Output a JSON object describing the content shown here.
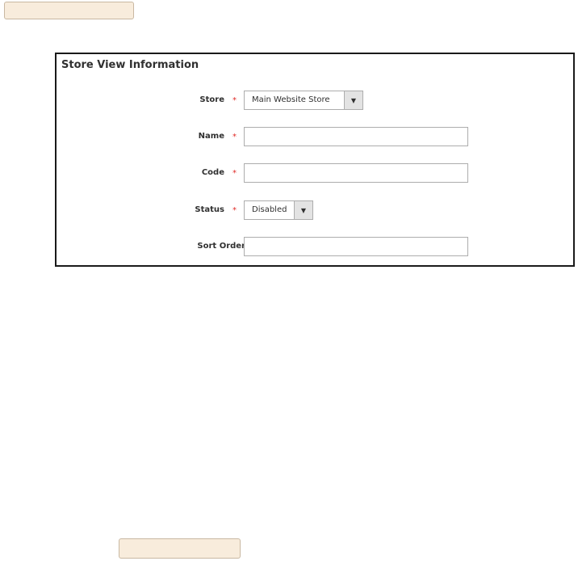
{
  "panel": {
    "title": "Store View Information"
  },
  "fields": {
    "store": {
      "label": "Store",
      "required_mark": "*",
      "value": "Main Website Store"
    },
    "name": {
      "label": "Name",
      "required_mark": "*",
      "value": ""
    },
    "code": {
      "label": "Code",
      "required_mark": "*",
      "value": ""
    },
    "status": {
      "label": "Status",
      "required_mark": "*",
      "value": "Disabled"
    },
    "sort_order": {
      "label": "Sort Order",
      "value": ""
    }
  },
  "icons": {
    "dropdown_arrow": "▼"
  },
  "colors": {
    "button_background": "#f8ecdc",
    "required_star": "#e02b27",
    "panel_border": "#1a1a1a"
  }
}
